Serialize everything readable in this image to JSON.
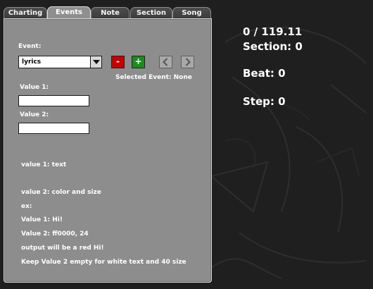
{
  "tabs": [
    {
      "label": "Charting",
      "active": false
    },
    {
      "label": "Events",
      "active": true
    },
    {
      "label": "Note",
      "active": false
    },
    {
      "label": "Section",
      "active": false
    },
    {
      "label": "Song",
      "active": false
    }
  ],
  "events": {
    "event_label": "Event:",
    "event_value": "lyrics",
    "minus_label": "-",
    "plus_label": "+",
    "selected_event": "Selected Event: None",
    "value1_label": "Value 1:",
    "value1_value": "",
    "value2_label": "Value 2:",
    "value2_value": "",
    "desc": [
      "value 1: text",
      "value 2: color and size",
      "ex:",
      "Value 1: Hi!",
      "Value 2: ff0000, 24",
      "output will be a red Hi!",
      "Keep Value 2 empty for white text and 40 size"
    ]
  },
  "stats": {
    "time": "0 / 119.11",
    "section": "Section: 0",
    "beat": "Beat: 0",
    "step": "Step: 0"
  },
  "colors": {
    "panel": "#8d8d8d",
    "remove_button": "#c80000",
    "add_button": "#1e8a1e"
  },
  "icons": [
    "chevron-down-icon",
    "chevron-left-icon",
    "chevron-right-icon"
  ]
}
